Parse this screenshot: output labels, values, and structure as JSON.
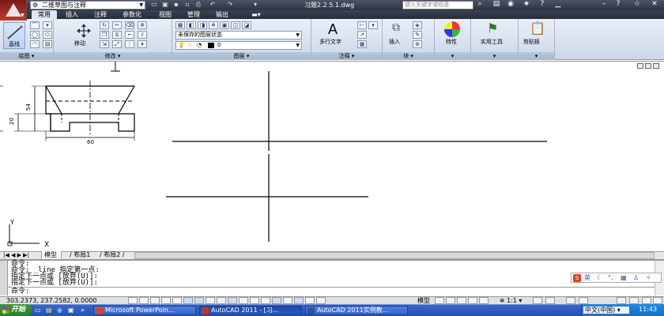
{
  "title_bar": {
    "workspace": "二维草图与注释",
    "document_title": "习题2.2.5.1.dwg",
    "search_placeholder": "键入关键字或短语"
  },
  "ribbon_tabs": [
    "常用",
    "插入",
    "注释",
    "参数化",
    "视图",
    "管理",
    "输出"
  ],
  "ribbon": {
    "groups": {
      "draw": "绘图",
      "modify": "修改",
      "layers": "图层",
      "annotation": "注释",
      "block": "块"
    },
    "draw_line_label": "直线",
    "move_label": "移动",
    "layer_state": "未保存的图层状态",
    "layer_value": "0",
    "multiline_text_label": "多行文字",
    "insert_label": "插入",
    "properties_label": "特性",
    "utilities_label": "实用工具",
    "clipboard_label": "剪贴板"
  },
  "drawing": {
    "dim_height": "54",
    "dim_inner": "20",
    "dim_width": "60",
    "ucs_y": "Y",
    "ucs_x": "X"
  },
  "layout_tabs": [
    "模型",
    "布局1",
    "布局2"
  ],
  "command_history": [
    "命令:",
    "命令: _line 指定第一点:",
    "指定下一点或 [放弃(U)]:",
    "指定下一点或 [放弃(U)]:"
  ],
  "command_prompt": "命令:",
  "ime_label": "英",
  "status": {
    "coords": "303.2373, 237.2582, 0.0000",
    "model_label": "模型",
    "scale_label": "1:1"
  },
  "taskbar": {
    "start_label": "开始",
    "tasks": [
      "Microsoft PowerPoin...",
      "AutoCAD 2011 - [习...",
      "AutoCAD 2011实例教..."
    ],
    "language": "中文(中国)",
    "clock": "11:43"
  },
  "colors": {
    "title_bg": "#2c3442",
    "ribbon_bg": "#dfe7f2",
    "taskbar_bg": "#2453b5",
    "start_bg": "#2b7d2b",
    "app_red": "#c03a2a"
  }
}
